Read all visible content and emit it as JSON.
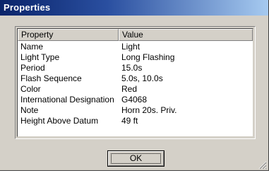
{
  "window": {
    "title": "Properties"
  },
  "table": {
    "columns": [
      "Property",
      "Value"
    ],
    "rows": [
      [
        "Name",
        "Light"
      ],
      [
        "Light Type",
        "Long Flashing"
      ],
      [
        "Period",
        "15.0s"
      ],
      [
        "Flash Sequence",
        "5.0s, 10.0s"
      ],
      [
        "Color",
        "Red"
      ],
      [
        "International Designation",
        "G4068"
      ],
      [
        "Note",
        "Horn 20s. Priv."
      ],
      [
        "Height Above Datum",
        "49 ft"
      ]
    ]
  },
  "buttons": {
    "ok_label": "OK"
  },
  "icons": {
    "resize_grip": "resize-grip-icon"
  },
  "colors": {
    "titlebar_start": "#0a246a",
    "titlebar_end": "#a6caf0",
    "dialog_face": "#d4d0c8"
  }
}
